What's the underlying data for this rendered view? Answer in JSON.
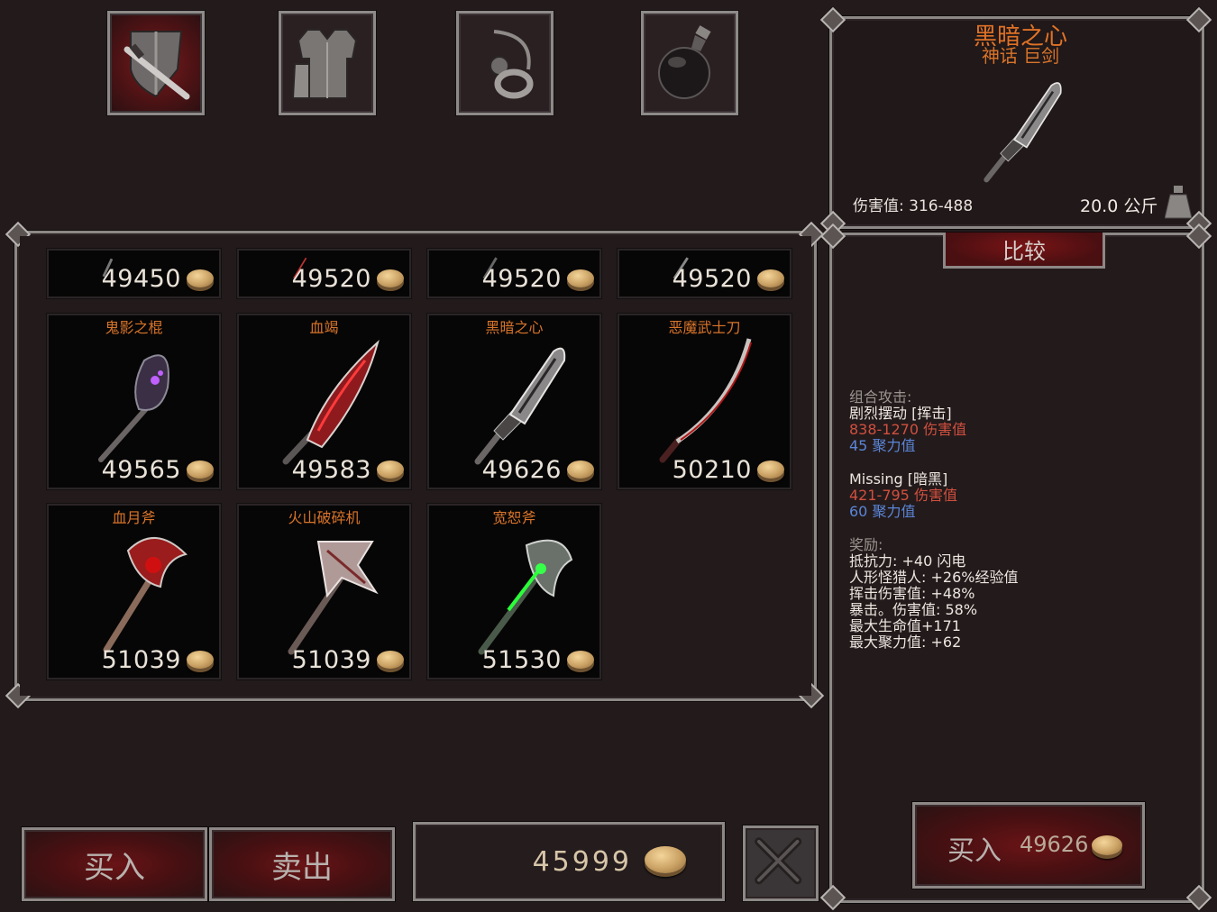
{
  "categories": [
    {
      "name": "weapons",
      "icon": "sword-shield-icon",
      "active": true
    },
    {
      "name": "armor",
      "icon": "armor-icon",
      "active": false
    },
    {
      "name": "jewelry",
      "icon": "jewelry-icon",
      "active": false
    },
    {
      "name": "potions",
      "icon": "potion-icon",
      "active": false
    }
  ],
  "grid": {
    "top_row_prices": [
      "49450",
      "49520",
      "49520",
      "49520"
    ],
    "items": [
      {
        "name": "鬼影之棍",
        "price": "49565",
        "icon": "ghost-staff-icon"
      },
      {
        "name": "血竭",
        "price": "49583",
        "icon": "blood-blade-icon"
      },
      {
        "name": "黑暗之心",
        "price": "49626",
        "icon": "dark-heart-greatsword-icon"
      },
      {
        "name": "恶魔武士刀",
        "price": "50210",
        "icon": "demon-katana-icon"
      },
      {
        "name": "血月斧",
        "price": "51039",
        "icon": "blood-moon-axe-icon"
      },
      {
        "name": "火山破碎机",
        "price": "51039",
        "icon": "volcano-crusher-icon"
      },
      {
        "name": "宽恕斧",
        "price": "51530",
        "icon": "forgiveness-axe-icon"
      }
    ]
  },
  "bottom_bar": {
    "buy_label": "买入",
    "sell_label": "卖出",
    "gold": "45999",
    "close_icon": "close-icon"
  },
  "detail": {
    "name": "黑暗之心",
    "subtitle": "神话 巨剑",
    "damage": "伤害值: 316-488",
    "weight": "20.0 公斤",
    "compare_label": "比较",
    "combo_heading": "组合攻击:",
    "combo1_name": "剧烈摆动 [挥击]",
    "combo1_damage": "838-1270 伤害值",
    "combo1_focus": "45 聚力值",
    "combo2_name": "Missing [暗黑]",
    "combo2_damage": "421-795 伤害值",
    "combo2_focus": "60 聚力值",
    "bonus_heading": "奖励:",
    "bonuses": [
      "抵抗力:  +40 闪电",
      "人形怪猎人:  +26%经验值",
      "挥击伤害值:  +48%",
      "暴击。伤害值:  58%",
      "最大生命值+171",
      "最大聚力值:  +62"
    ],
    "buy_label": "买入",
    "buy_price": "49626"
  },
  "colors": {
    "background": "#231a1b",
    "item_name": "#d8742a",
    "damage_red": "#d0503f",
    "focus_blue": "#5a86d8"
  }
}
